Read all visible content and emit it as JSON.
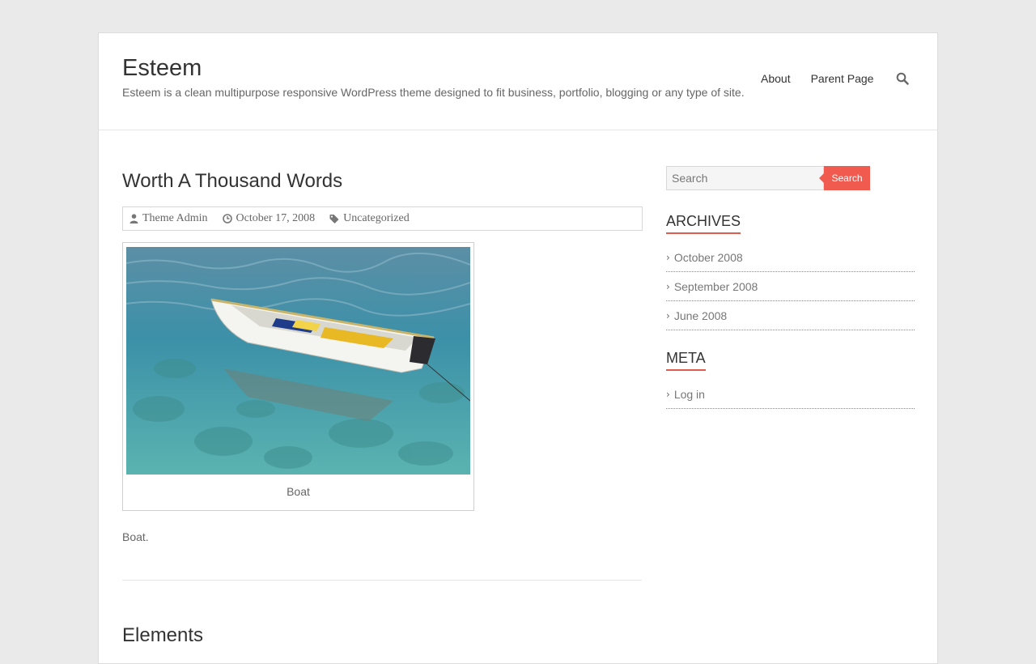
{
  "header": {
    "site_title": "Esteem",
    "site_description": "Esteem is a clean multipurpose responsive WordPress theme designed to fit business, portfolio, blogging or any type of site.",
    "nav": [
      "About",
      "Parent Page"
    ],
    "search_icon": "search-icon"
  },
  "post": {
    "title": "Worth A Thousand Words",
    "meta": {
      "author": "Theme Admin",
      "date": "October 17, 2008",
      "category": "Uncategorized"
    },
    "image_caption": "Boat",
    "excerpt": "Boat."
  },
  "next_post": {
    "title": "Elements"
  },
  "sidebar": {
    "search": {
      "placeholder": "Search",
      "button_label": "Search"
    },
    "archives": {
      "title": "ARCHIVES",
      "items": [
        "October 2008",
        "September 2008",
        "June 2008"
      ]
    },
    "meta": {
      "title": "META",
      "items": [
        "Log in"
      ]
    }
  },
  "colors": {
    "accent": "#f05a4f",
    "background": "#eaeaea"
  }
}
